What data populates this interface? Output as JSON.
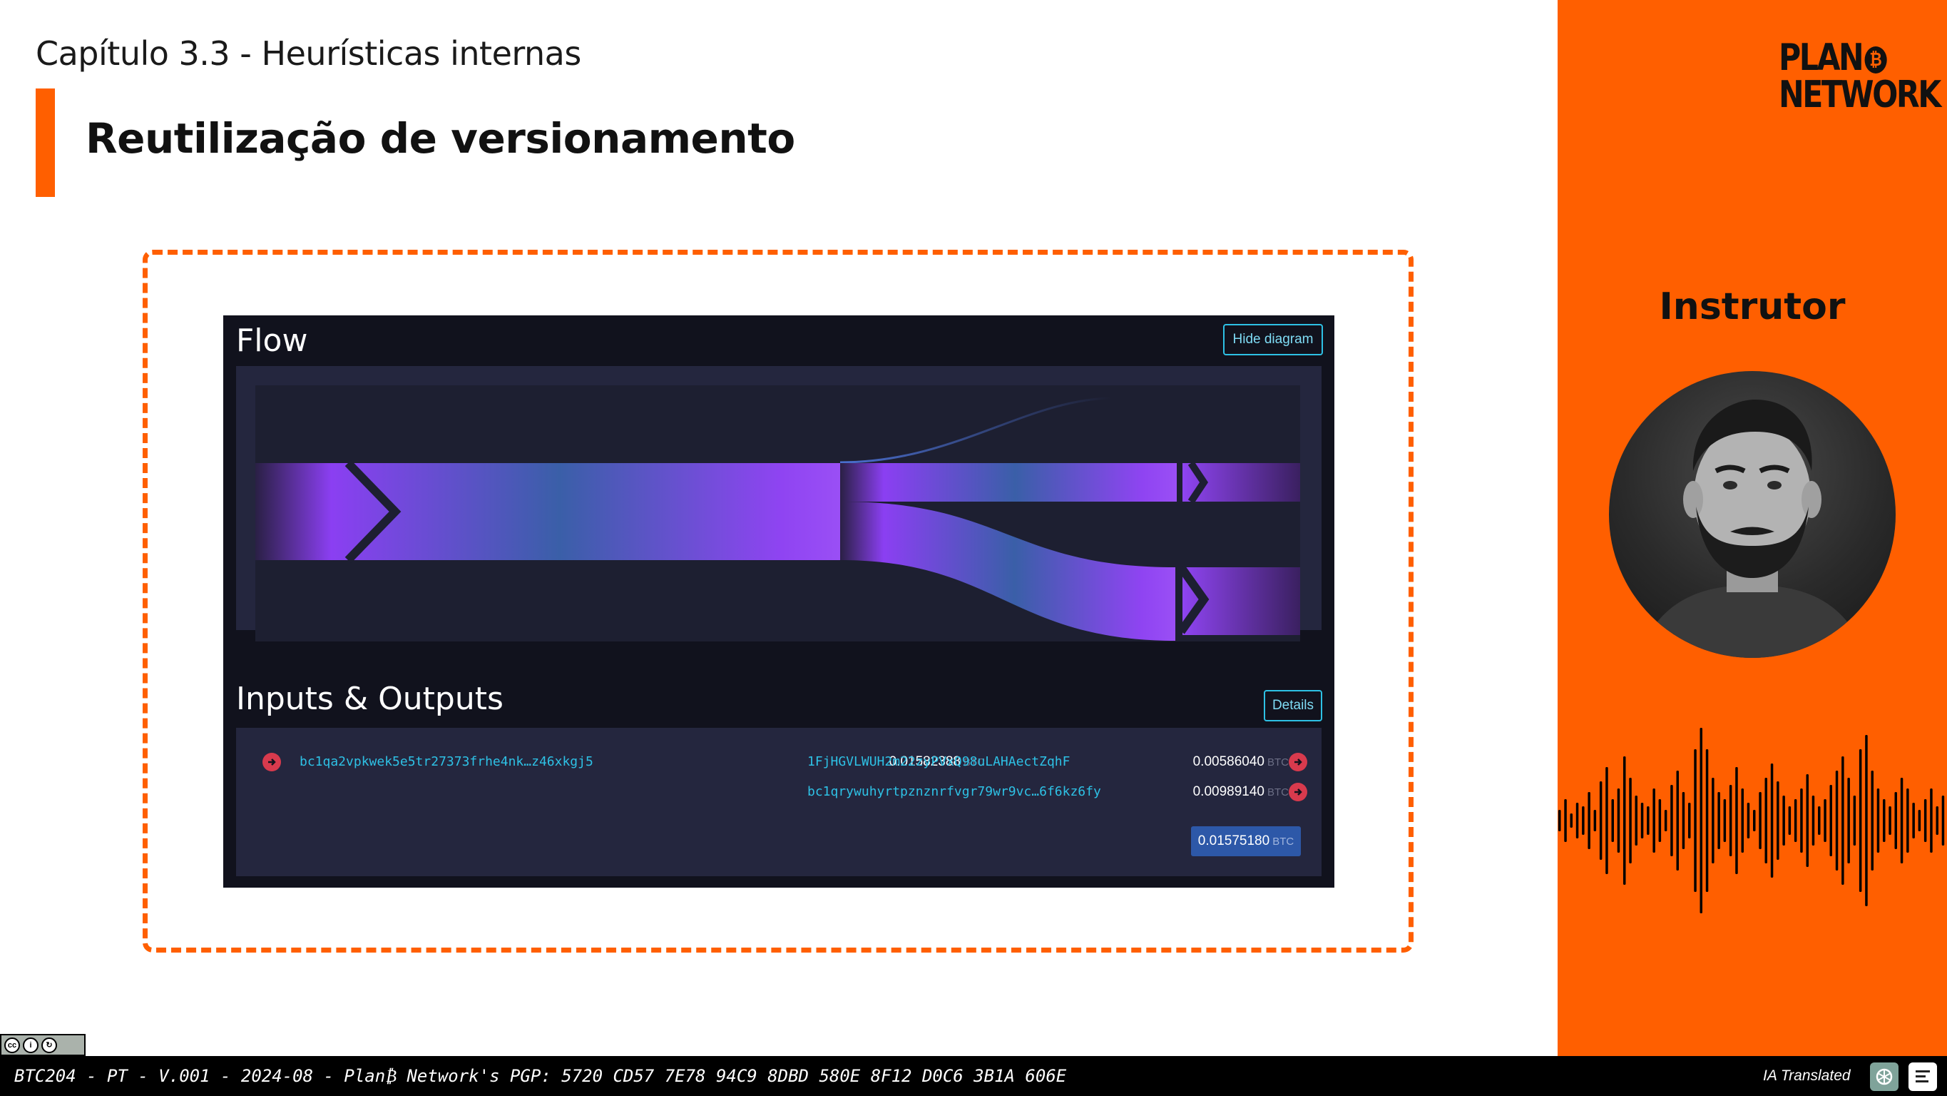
{
  "header": {
    "chapter": "Capítulo 3.3 - Heurísticas internas",
    "title": "Reutilização de versionamento"
  },
  "mempool": {
    "flow_title": "Flow",
    "hide_diagram_label": "Hide diagram",
    "io_title": "Inputs & Outputs",
    "details_label": "Details",
    "inputs": [
      {
        "address": "bc1qa2vpkwek5e5tr27373frhe4nk…z46xkgj5",
        "amount": "0.01582388",
        "unit": "BTC"
      }
    ],
    "outputs": [
      {
        "address": "1FjHGVLWUH2m22zyPVxQ98uLAHAectZqhF",
        "amount": "0.00586040",
        "unit": "BTC"
      },
      {
        "address": "bc1qrywuhyrtpznznrfvgr79wr9vc…6f6kz6fy",
        "amount": "0.00989140",
        "unit": "BTC"
      }
    ],
    "total_amount": "0.01575180",
    "total_unit": "BTC",
    "colors": {
      "flow_start": "#8b3ff2",
      "flow_mid": "#3a5fa8",
      "flow_end": "#8f44f2",
      "address": "#2ec1e5",
      "arrow": "#d83a4d"
    }
  },
  "sidebar": {
    "logo_line1": "PLAN",
    "logo_b": "₿",
    "logo_line2": "NETWORK",
    "instructor_label": "Instrutor"
  },
  "footer": {
    "text": "BTC204 - PT - V.001 - 2024-08 - Plan₿ Network's PGP: 5720 CD57 7E78 94C9 8DBD 580E 8F12 D0C6 3B1A 606E",
    "ia_label": "IA Translated",
    "license": "CC BY SA"
  },
  "icons": {
    "arrow": "arrow-right-circle-icon",
    "openai": "openai-logo-icon",
    "translator": "translator-logo-icon"
  }
}
